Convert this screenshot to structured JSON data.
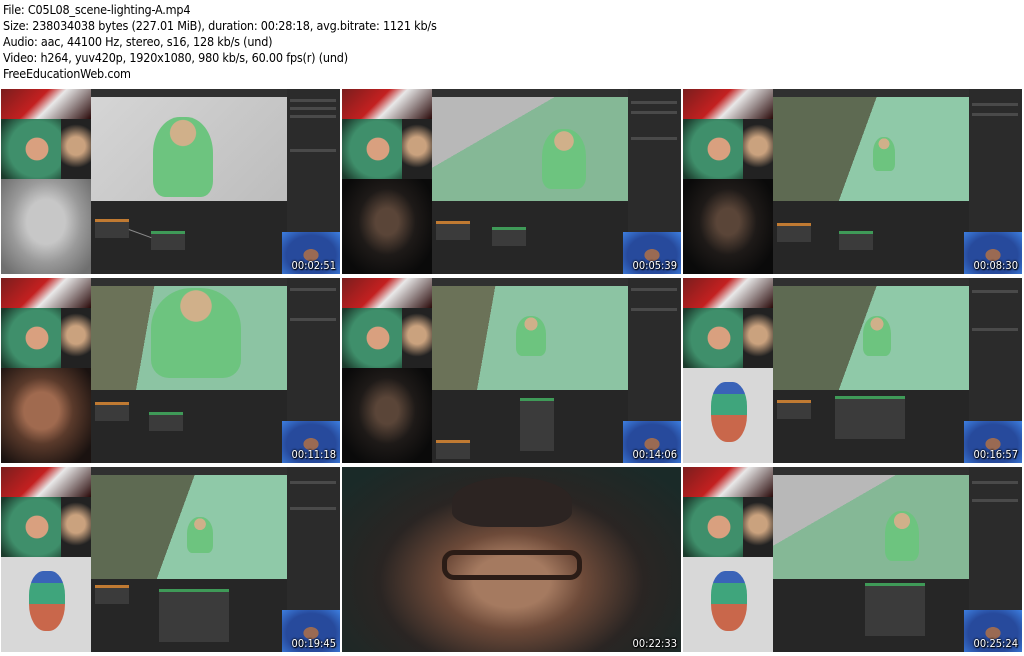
{
  "header": {
    "file_line": "File: C05L08_scene-lighting-A.mp4",
    "size_line": "Size: 238034038 bytes (227.01 MiB), duration: 00:28:18, avg.bitrate: 1121 kb/s",
    "audio_line": "Audio: aac, 44100 Hz, stereo, s16, 128 kb/s (und)",
    "video_line": "Video: h264, yuv420p, 1920x1080, 980 kb/s, 60.00 fps(r) (und)",
    "watermark": "FreeEducationWeb.com"
  },
  "thumbnails": [
    {
      "timestamp": "00:02:51"
    },
    {
      "timestamp": "00:05:39"
    },
    {
      "timestamp": "00:08:30"
    },
    {
      "timestamp": "00:11:18"
    },
    {
      "timestamp": "00:14:06"
    },
    {
      "timestamp": "00:16:57"
    },
    {
      "timestamp": "00:19:45"
    },
    {
      "timestamp": "00:22:33"
    },
    {
      "timestamp": "00:25:24"
    }
  ]
}
